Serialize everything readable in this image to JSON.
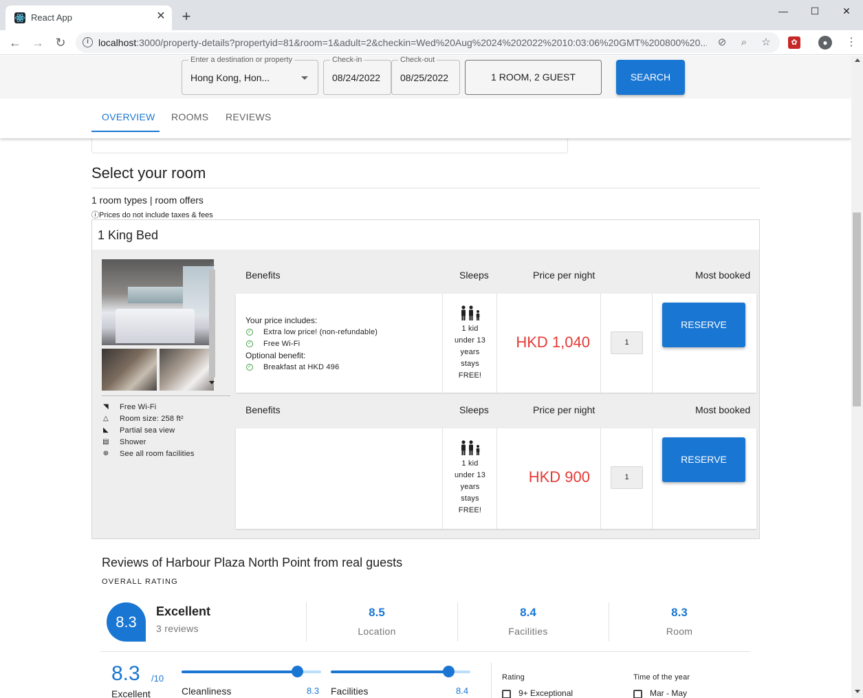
{
  "browser": {
    "tab_title": "React App",
    "url_host": "localhost",
    "url_rest": ":3000/property-details?propertyid=81&room=1&adult=2&checkin=Wed%20Aug%2024%202022%2010:03:06%20GMT%200800%20..."
  },
  "search": {
    "destination_label": "Enter a destination or property",
    "destination_value": "Hong Kong, Hon...",
    "checkin_label": "Check-in",
    "checkin_value": "08/24/2022",
    "checkout_label": "Check-out",
    "checkout_value": "08/25/2022",
    "guests_label": "1 ROOM, 2 GUEST",
    "search_label": "SEARCH"
  },
  "tabs": [
    "OVERVIEW",
    "ROOMS",
    "REVIEWS"
  ],
  "rooms": {
    "heading": "Select your room",
    "summary": "1 room types | room offers",
    "prices_note": "ⓘPrices do not include taxes & fees",
    "room_name": "1 King Bed",
    "facilities": [
      {
        "icon": "wifi-icon",
        "label": "Free Wi-Fi"
      },
      {
        "icon": "room-size-icon",
        "label": "Room size: 258 ft²"
      },
      {
        "icon": "sea-view-icon",
        "label": "Partial sea view"
      },
      {
        "icon": "shower-icon",
        "label": "Shower"
      },
      {
        "icon": "plus-circle-icon",
        "label": "See all room facilities"
      }
    ],
    "columns": {
      "benefits": "Benefits",
      "sleeps": "Sleeps",
      "price": "Price per night",
      "most_booked": "Most booked"
    },
    "offers": [
      {
        "includes_label": "Your price includes:",
        "includes": [
          "Extra low price! (non-refundable)",
          "Free Wi-Fi"
        ],
        "optional_label": "Optional benefit:",
        "optional": [
          "Breakfast at HKD 496"
        ],
        "sleeps_lines": [
          "1 kid",
          "under 13",
          "years",
          "stays",
          "FREE!"
        ],
        "price": "HKD 1,040",
        "qty": "1",
        "reserve_label": "RESERVE"
      },
      {
        "sleeps_lines": [
          "1 kid",
          "under 13",
          "years",
          "stays",
          "FREE!"
        ],
        "price": "HKD 900",
        "qty": "1",
        "reserve_label": "RESERVE"
      }
    ]
  },
  "reviews": {
    "title": "Reviews of Harbour Plaza North Point from real guests",
    "overall_label": "OVERALL RATING",
    "score": "8.3",
    "word": "Excellent",
    "count": "3 reviews",
    "sub_scores": [
      {
        "value": "8.5",
        "label": "Location"
      },
      {
        "value": "8.4",
        "label": "Facilities"
      },
      {
        "value": "8.3",
        "label": "Room"
      }
    ],
    "detail": {
      "score": "8.3",
      "out_of": "/10",
      "word": "Excellent",
      "sliders": [
        {
          "label": "Cleanliness",
          "value": "8.3",
          "fraction": 0.83
        },
        {
          "label": "Facilities",
          "value": "8.4",
          "fraction": 0.84
        }
      ]
    },
    "filters": {
      "rating_label": "Rating",
      "rating_option": "9+ Exceptional",
      "time_label": "Time of the year",
      "time_option": "Mar - May"
    }
  }
}
